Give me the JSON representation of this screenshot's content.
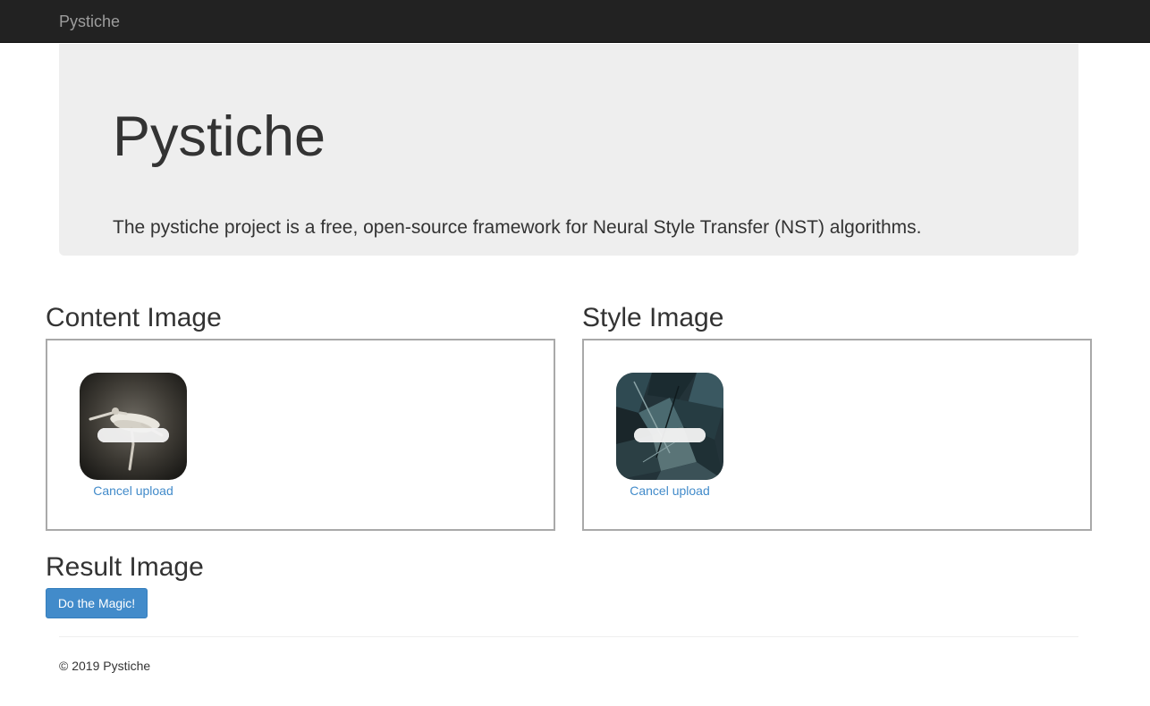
{
  "navbar": {
    "brand": "Pystiche"
  },
  "jumbotron": {
    "title": "Pystiche",
    "lead": "The pystiche project is a free, open-source framework for Neural Style Transfer (NST) algorithms."
  },
  "content_section": {
    "title": "Content Image",
    "preview": {
      "remove_label": "Cancel upload"
    }
  },
  "style_section": {
    "title": "Style Image",
    "preview": {
      "remove_label": "Cancel upload"
    }
  },
  "result_section": {
    "title": "Result Image",
    "button_label": "Do the Magic!"
  },
  "footer": {
    "text": "© 2019 Pystiche"
  },
  "colors": {
    "navbar_bg": "#222222",
    "brand": "#9d9d9d",
    "jumbotron_bg": "#eeeeee",
    "link": "#428bca",
    "primary_button": "#428bca"
  }
}
